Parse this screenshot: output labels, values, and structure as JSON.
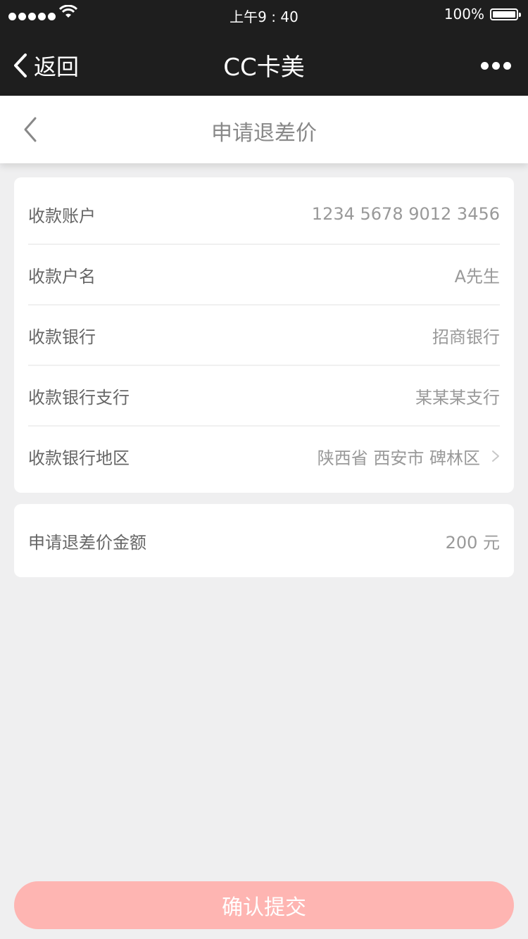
{
  "status_bar": {
    "time": "上午9 : 40",
    "battery": "100%"
  },
  "navbar": {
    "back_label": "返回",
    "title": "CC卡美"
  },
  "page": {
    "title": "申请退差价"
  },
  "account_rows": [
    {
      "label": "收款账户",
      "value": "1234 5678 9012 3456"
    },
    {
      "label": "收款户名",
      "value": "A先生"
    },
    {
      "label": "收款银行",
      "value": "招商银行"
    },
    {
      "label": "收款银行支行",
      "value": "某某某支行"
    },
    {
      "label": "收款银行地区",
      "value": "陕西省 西安市 碑林区"
    }
  ],
  "amount_row": {
    "label": "申请退差价金额",
    "value": "200 元"
  },
  "submit_label": "确认提交",
  "colors": {
    "nav_bg": "#1e1e1e",
    "page_bg": "#efeff0",
    "card_bg": "#FFFFFF",
    "divider": "#F0F0F0",
    "label_text": "#666666",
    "value_text": "#999999",
    "submit_bg": "#feb5b2"
  }
}
